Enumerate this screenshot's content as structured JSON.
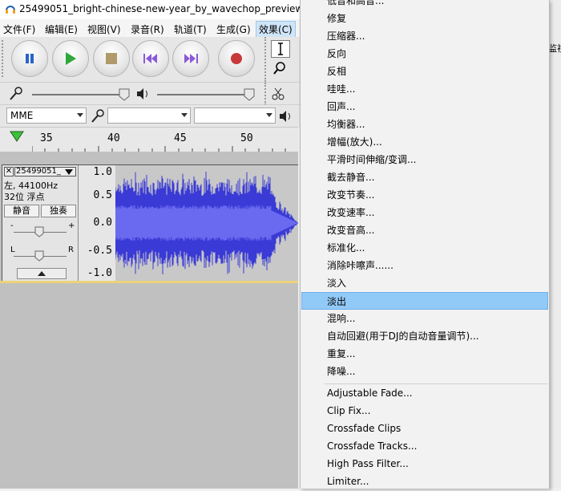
{
  "window": {
    "title": "25499051_bright-chinese-new-year_by_wavechop_preview"
  },
  "menubar": {
    "items": [
      "文件(F)",
      "编辑(E)",
      "视图(V)",
      "录音(R)",
      "轨道(T)",
      "生成(G)",
      "效果(C)"
    ]
  },
  "toolbar": {
    "transport": [
      "pause-icon",
      "play-icon",
      "stop-icon",
      "skip-start-icon",
      "skip-end-icon",
      "record-icon"
    ]
  },
  "device": {
    "host": "MME"
  },
  "ruler": {
    "ticks": [
      "35",
      "40",
      "45",
      "50"
    ]
  },
  "track": {
    "name": "25499051_",
    "info_line1": "左, 44100Hz",
    "info_line2": "32位 浮点",
    "mute_label": "静音",
    "solo_label": "独奏",
    "yaxis": [
      "1.0",
      "0.5",
      "0.0",
      "-0.5",
      "-1.0"
    ],
    "wave_color": "#3a3ad6"
  },
  "effect_menu": {
    "items_cn": [
      "低音和高音...",
      "修复",
      "压缩器...",
      "反向",
      "反相",
      "哇哇...",
      "回声...",
      "均衡器...",
      "增幅(放大)...",
      "平滑时间伸缩/变调...",
      "截去静音...",
      "改变节奏...",
      "改变速率...",
      "改变音高...",
      "标准化...",
      "消除咔嚓声......",
      "淡入",
      "淡出",
      "混响...",
      "自动回避(用于DJ的自动音量调节)...",
      "重复...",
      "降噪..."
    ],
    "highlighted": "淡出",
    "items_en": [
      "Adjustable Fade...",
      "Clip Fix...",
      "Crossfade Clips",
      "Crossfade Tracks...",
      "High Pass Filter...",
      "Limiter..."
    ]
  },
  "right_edge": {
    "partial_text": "监视"
  },
  "colors": {
    "highlight": "#91c9f7",
    "wave": "#3a3ad6"
  }
}
